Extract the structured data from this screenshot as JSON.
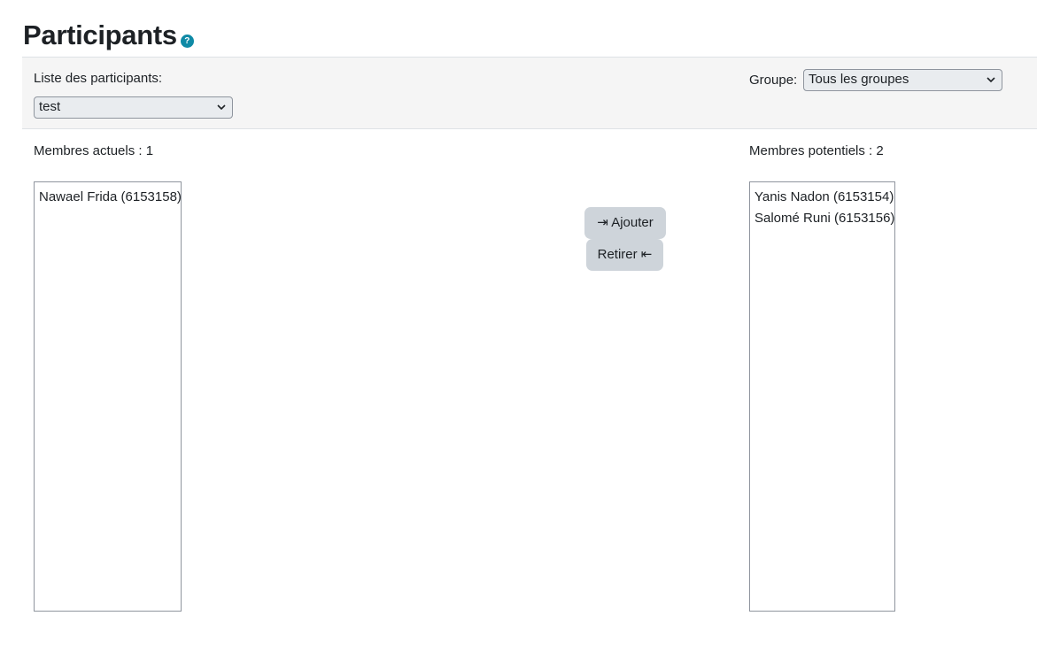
{
  "page": {
    "title": "Participants",
    "help_icon": "?"
  },
  "filters": {
    "participants_label": "Liste des participants:",
    "participants_selected": "test",
    "group_label": "Groupe:",
    "group_selected": "Tous les groupes"
  },
  "current_members": {
    "label": "Membres actuels : 1",
    "items": [
      "Nawael Frida (6153158)"
    ]
  },
  "potential_members": {
    "label": "Membres potentiels : 2",
    "items": [
      "Yanis Nadon (6153154)",
      "Salomé Runi (6153156)"
    ]
  },
  "actions": {
    "add_label": "⇥ Ajouter",
    "remove_label": "Retirer ⇤"
  },
  "icons": {
    "help": "help-icon",
    "dropdown": "chevron-down-icon"
  },
  "colors": {
    "help_icon": "#0f8aa6",
    "button_bg": "#ced4da",
    "select_bg": "#e9ecef",
    "filter_bar_bg": "#f5f5f5"
  }
}
